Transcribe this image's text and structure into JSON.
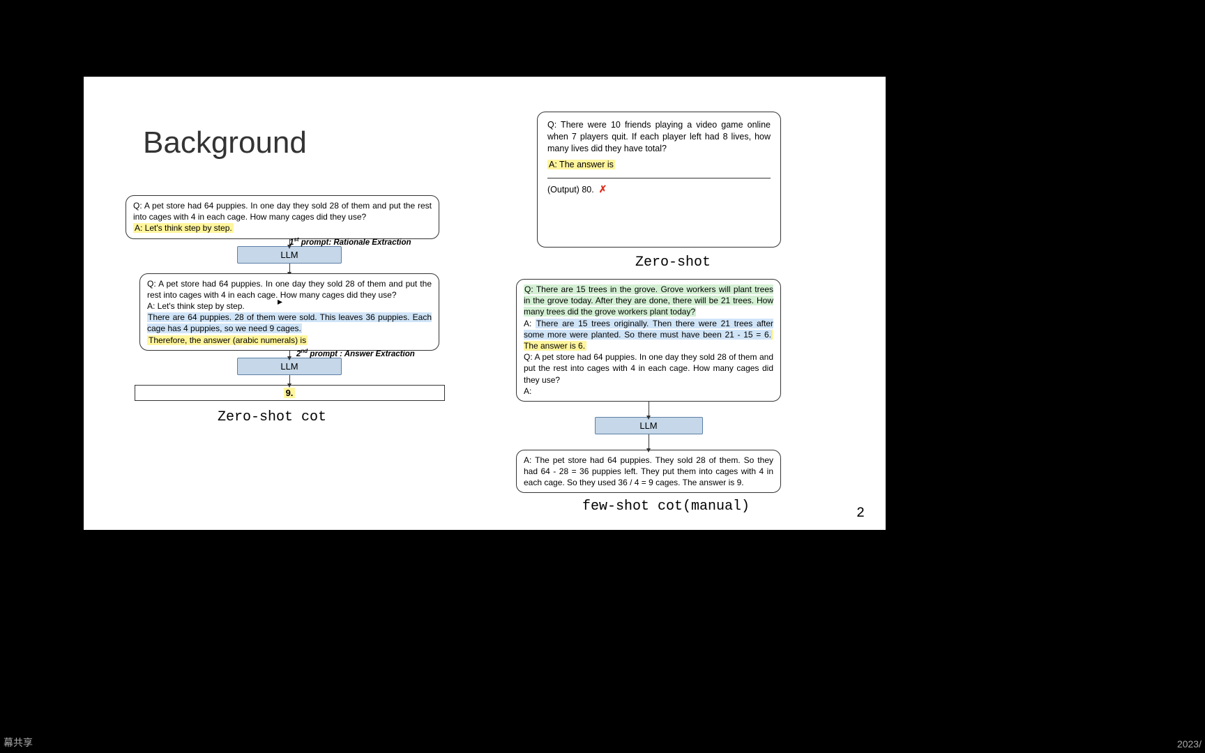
{
  "title": "Background",
  "page_number": "2",
  "footer_left": "幕共享",
  "footer_right": "2023/",
  "zeroshot_cot": {
    "caption": "Zero-shot cot",
    "box1_q": "Q: A pet store had 64 puppies. In one day they sold 28 of them and put the rest into cages with 4 in each cage. How many cages did they use?",
    "box1_a": "A: Let's think step by step.",
    "prompt1_label_prefix": "1",
    "prompt1_label_sup": "st",
    "prompt1_label_text": " prompt: Rationale Extraction",
    "llm_label": "LLM",
    "box2_q": "Q: A pet store had 64 puppies. In one day they sold 28 of them and put the rest into cages with 4 in each cage. How many cages did they use?",
    "box2_a": "A: Let's think step by step.",
    "box2_reasoning": "There are 64 puppies. 28 of them were sold. This leaves 36 puppies. Each cage has 4 puppies, so we need 9 cages.",
    "box2_therefore": "Therefore, the answer (arabic numerals) is",
    "prompt2_label_prefix": "2",
    "prompt2_label_sup": "nd",
    "prompt2_label_text": " prompt : Answer Extraction",
    "final_answer": "9."
  },
  "zeroshot": {
    "caption": "Zero-shot",
    "q": "Q: There were 10 friends playing a video game online when 7 players quit. If each player left had 8 lives, how many lives did they have total?",
    "a": "A: The answer is",
    "output": "(Output) 80.",
    "cross": "✗"
  },
  "fewshot": {
    "caption": "few-shot cot(manual)",
    "box1_q1": "Q: There are 15 trees in the grove. Grove workers will plant trees in the grove today. After they are done, there will be 21 trees. How many trees did the grove workers plant today?",
    "box1_a1_pre": "A: ",
    "box1_a1": "There are 15 trees originally. Then there were 21 trees after some more were planted. So there must have been 21 - 15 = 6.",
    "box1_a1_ans": " The answer is 6.",
    "box1_q2": "Q: A pet store had 64 puppies. In one day they sold 28 of them and put the rest into cages with 4 in each cage. How many cages did they use?",
    "box1_a2": "A:",
    "llm_label": "LLM",
    "box2_a": "A: The pet store had 64 puppies. They sold 28 of them. So they had 64 - 28 = 36 puppies left. They put them into cages with 4 in each cage. So they used 36 / 4 = 9 cages. The answer is 9."
  }
}
